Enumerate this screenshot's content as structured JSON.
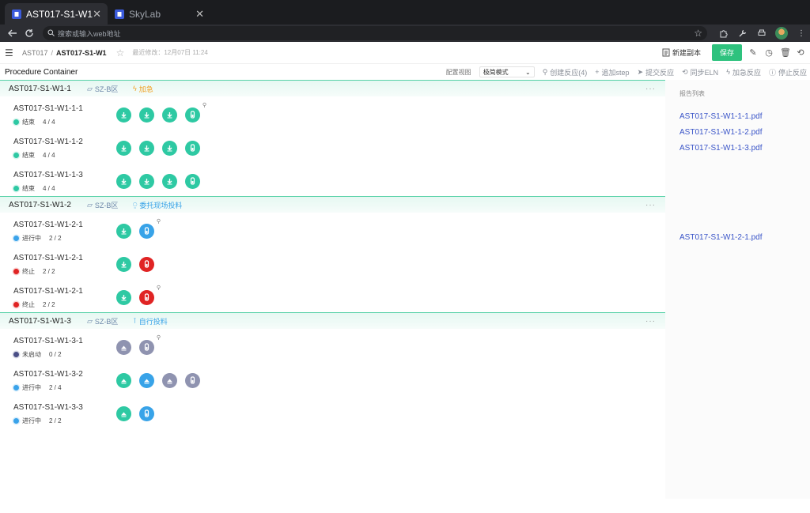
{
  "browser": {
    "tabs": [
      {
        "title": "AST017-S1-W1",
        "active": true
      },
      {
        "title": "SkyLab",
        "active": false
      }
    ],
    "address_placeholder": "搜索或输入web地址"
  },
  "topbar": {
    "breadcrumb": [
      "AST017",
      "AST017-S1-W1"
    ],
    "modified": "最近修改：12月07日  11:24",
    "new_copy": "新建副本",
    "save": "保存"
  },
  "toolbar": {
    "title": "Procedure Container",
    "view_label": "配置视图",
    "view_value": "极简模式",
    "actions": [
      "创建反应(4)",
      "追加step",
      "提交反应",
      "同步ELN",
      "加急反应",
      "停止反应"
    ]
  },
  "colors": {
    "green": "#2ec9a3",
    "blue": "#38a3e8",
    "red": "#e02424",
    "gray": "#8f93b0",
    "done": "#2ec9a3",
    "running": "#3aa3ea",
    "stopped": "#e02424",
    "notstarted": "#4a4f86"
  },
  "groups": [
    {
      "name": "AST017-S1-W1-1",
      "zone": "SZ-B区",
      "tag": "加急",
      "tag_color": "#f0a020",
      "tag_icon": "lightning-icon",
      "rows": [
        {
          "name": "AST017-S1-W1-1-1",
          "status": "结束",
          "status_key": "done",
          "count": "4 / 4",
          "steps": [
            "green-down",
            "green-down",
            "green-down",
            "green-flask-zoom"
          ]
        },
        {
          "name": "AST017-S1-W1-1-2",
          "status": "结束",
          "status_key": "done",
          "count": "4 / 4",
          "steps": [
            "green-down",
            "green-down",
            "green-down",
            "green-flask"
          ]
        },
        {
          "name": "AST017-S1-W1-1-3",
          "status": "结束",
          "status_key": "done",
          "count": "4 / 4",
          "steps": [
            "green-down",
            "green-down",
            "green-down",
            "green-flask"
          ]
        }
      ]
    },
    {
      "name": "AST017-S1-W1-2",
      "zone": "SZ-B区",
      "tag": "委托现场投料",
      "tag_color": "#38a3e8",
      "tag_icon": "person-icon",
      "rows": [
        {
          "name": "AST017-S1-W1-2-1",
          "status": "进行中",
          "status_key": "running",
          "count": "2 / 2",
          "steps": [
            "green-down",
            "blue-flask-zoom"
          ]
        },
        {
          "name": "AST017-S1-W1-2-1",
          "status": "终止",
          "status_key": "stopped",
          "count": "2 / 2",
          "steps": [
            "green-down",
            "red-flask"
          ]
        },
        {
          "name": "AST017-S1-W1-2-1",
          "status": "终止",
          "status_key": "stopped",
          "count": "2 / 2",
          "steps": [
            "green-down",
            "red-flask-zoom"
          ]
        }
      ]
    },
    {
      "name": "AST017-S1-W1-3",
      "zone": "SZ-B区",
      "tag": "自行投料",
      "tag_color": "#38a3e8",
      "tag_icon": "test-tube-icon",
      "rows": [
        {
          "name": "AST017-S1-W1-3-1",
          "status": "未启动",
          "status_key": "notstarted",
          "count": "0 / 2",
          "steps": [
            "gray-up",
            "gray-flask-zoom"
          ]
        },
        {
          "name": "AST017-S1-W1-3-2",
          "status": "进行中",
          "status_key": "running",
          "count": "2 / 4",
          "steps": [
            "green-up",
            "blue-up",
            "gray-up",
            "gray-flask"
          ]
        },
        {
          "name": "AST017-S1-W1-3-3",
          "status": "进行中",
          "status_key": "running",
          "count": "2 / 2",
          "steps": [
            "green-up",
            "blue-flask"
          ]
        }
      ]
    }
  ],
  "reports": {
    "title": "报告列表",
    "files": [
      "AST017-S1-W1-1-1.pdf",
      "AST017-S1-W1-1-2.pdf",
      "AST017-S1-W1-1-3.pdf",
      "AST017-S1-W1-2-1.pdf"
    ]
  }
}
